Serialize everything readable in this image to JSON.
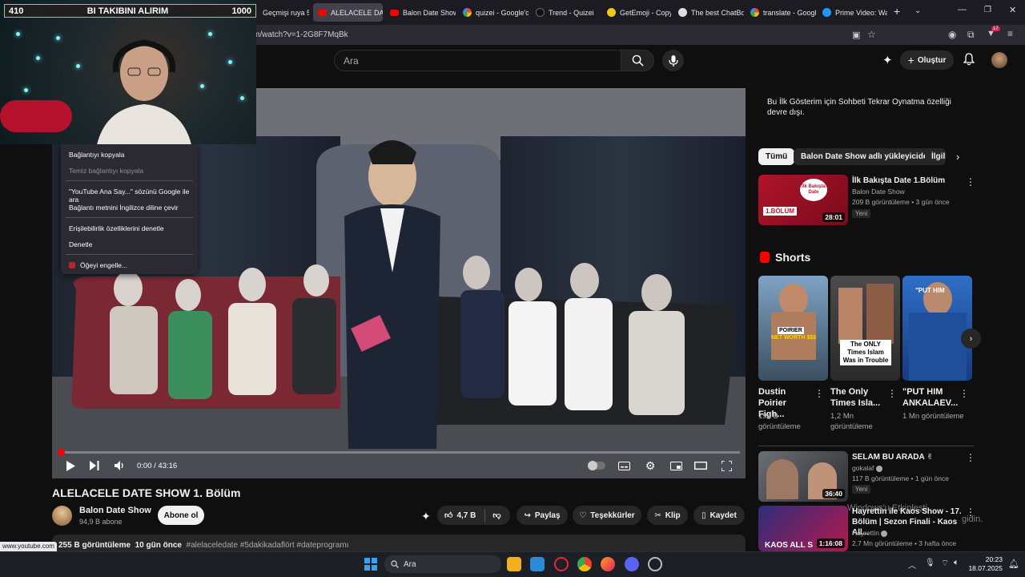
{
  "browser": {
    "tabs": [
      {
        "label": "Geçmişi ruya 5 - You",
        "active": false
      },
      {
        "label": "ALELACELE DA",
        "active": true
      },
      {
        "label": "Balon Date Show",
        "active": false
      },
      {
        "label": "quizei - Google'd",
        "active": false
      },
      {
        "label": "Trend - Quizei",
        "active": false
      },
      {
        "label": "GetEmoji - Copy",
        "active": false
      },
      {
        "label": "The best ChatBot",
        "active": false
      },
      {
        "label": "translate - Googl",
        "active": false
      },
      {
        "label": "Prime Video: Wat",
        "active": false
      }
    ],
    "new_tab": "+",
    "url": "m/watch?v=1-2G8F7MqBk",
    "status_url": "www.youtube.com",
    "ext_badge": "17"
  },
  "overlay": {
    "goal_left": "410",
    "goal_text": "BI TAKIBINI ALIRIM",
    "goal_right": "1000"
  },
  "youtube": {
    "search_placeholder": "Ara",
    "create_label": "Oluştur"
  },
  "context_menu": {
    "items": [
      {
        "label": "Bağlantıyı kopyala",
        "disabled": false
      },
      {
        "label": "Temiz bağlantıyı kopyala",
        "disabled": true
      },
      {
        "label": "\"YouTube Ana Say...\" sözünü Google ile ara",
        "disabled": false
      },
      {
        "label": "Bağlantı metnini İngilizce diline çevir",
        "disabled": false
      },
      {
        "label": "Erişilebilirlik özelliklerini denetle",
        "disabled": false
      },
      {
        "label": "Denetle",
        "disabled": false
      },
      {
        "label": "Öğeyi engelle...",
        "disabled": false
      }
    ]
  },
  "player": {
    "time": "0:00 / 43:16",
    "progress": 0.003
  },
  "video": {
    "title": "ALELACELE DATE SHOW 1. Bölüm",
    "channel": "Balon Date Show",
    "subscribers": "94,9 B abone",
    "subscribe_label": "Abone ol",
    "likes": "4,7 B",
    "share_label": "Paylaş",
    "thanks_label": "Teşekkürler",
    "clip_label": "Klip",
    "save_label": "Kaydet",
    "views": "255 B görüntüleme",
    "age": "10 gün önce",
    "tags": "#alelaceledate #5dakikadaflört #dateprogramı"
  },
  "sidebar": {
    "chat_note": "Bu İlk Gösterim için Sohbeti Tekrar Oynatma özelliği devre dışı.",
    "chips": [
      "Tümü",
      "Balon Date Show adlı yükleyiciden",
      "İlgili"
    ],
    "recommended": [
      {
        "title": "İlk Bakışta Date 1.Bölüm",
        "channel": "Balon Date Show",
        "meta": "209 B görüntüleme • 3 gün önce",
        "badge": "Yeni",
        "duration": "28:01",
        "thumb_text": "İlk Bakışta Date",
        "thumb_tag": "1.BÖLÜM"
      }
    ],
    "shorts_title": "Shorts",
    "shorts": [
      {
        "title": "Dustin Poirier Figh...",
        "views": "194 B görüntüleme",
        "overlay_a": "POIRIER",
        "overlay_b": "NET WORTH $$$"
      },
      {
        "title": "The Only Times Isla...",
        "views": "1,2 Mn görüntüleme",
        "overlay_a": "The ONLY Times Islam Was in Trouble",
        "overlay_b": ""
      },
      {
        "title": "\"PUT HIM ANKALAEV...",
        "views": "1 Mn görüntüleme",
        "overlay_a": "\"PUT HIM",
        "overlay_b": ""
      }
    ],
    "more": [
      {
        "title": "SELAM BU ARADA ✌",
        "channel": "gokalaf",
        "meta": "117 B görüntüleme • 1 gün önce",
        "badge": "Yeni",
        "duration": "36:40"
      },
      {
        "title": "Hayrettin ile Kaos Show - 17. Bölüm | Sezon Finali - Kaos All...",
        "channel": "Hayrettin",
        "meta": "2,7 Mn görüntüleme • 3 hafta önce",
        "badge": "",
        "duration": "1:16:08",
        "thumb_text": "KAOS ALL S"
      }
    ],
    "watermark_line1": "Windows'u Etkinleşti",
    "watermark_line2": "gidin."
  },
  "taskbar": {
    "search_label": "Ara",
    "time": "20:23",
    "date": "18.07.2025"
  },
  "colors": {
    "accent_red": "#ff0000",
    "bg": "#0f0f0f",
    "chip_bg": "#272727"
  }
}
